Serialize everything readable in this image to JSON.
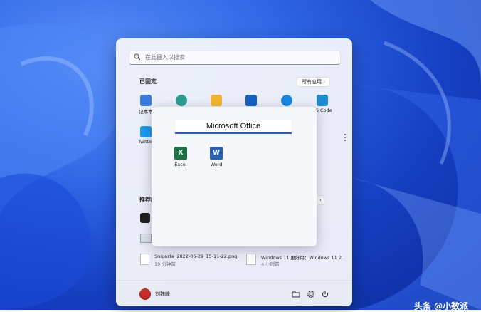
{
  "search": {
    "placeholder": "在此键入以搜索"
  },
  "pinned": {
    "title": "已固定",
    "all_apps": "所有应用",
    "all_apps_chevron": "›",
    "items": [
      {
        "label": "记事本",
        "icon": "notepad-icon",
        "color": "#3b7be0"
      },
      {
        "label": "",
        "icon": "paint-icon",
        "color": "#2a9d8f"
      },
      {
        "label": "",
        "icon": "file-explorer-icon",
        "color": "#f2b632"
      },
      {
        "label": "",
        "icon": "media-player-icon",
        "color": "#1461c7"
      },
      {
        "label": "",
        "icon": "cortana-icon",
        "color": "#1a86e0"
      },
      {
        "label": "VS Code",
        "icon": "vscode-icon",
        "color": "#1f8ad2"
      },
      {
        "label": "Twitter",
        "icon": "twitter-icon",
        "color": "#1d9bf0"
      }
    ]
  },
  "folder": {
    "name": "Microsoft Office",
    "apps": [
      {
        "label": "Excel",
        "icon": "excel-icon",
        "letter": "X",
        "color": "#1d7044"
      },
      {
        "label": "Word",
        "icon": "word-icon",
        "letter": "W",
        "color": "#2b5fb4"
      }
    ]
  },
  "recommended": {
    "title": "推荐的",
    "more_chevron": "›",
    "items": [
      {
        "title": "Snipaste_2022-05-29_15-11-22.png",
        "time": "19 分钟前",
        "icon": "image-file-icon"
      },
      {
        "title": "Windows 11 更好用：Windows 11 2...",
        "time": "4 小时前",
        "icon": "document-file-icon"
      }
    ]
  },
  "footer": {
    "user_name": "刘魏峰"
  },
  "watermark": "头条 @小数派"
}
